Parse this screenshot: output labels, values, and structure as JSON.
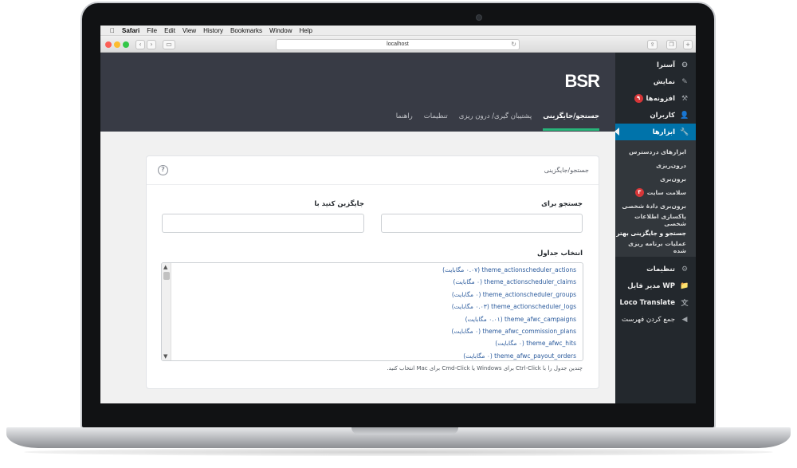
{
  "menubar": {
    "apple": "",
    "app": "Safari",
    "items": [
      "File",
      "Edit",
      "View",
      "History",
      "Bookmarks",
      "Window",
      "Help"
    ]
  },
  "browser": {
    "url": "localhost",
    "back": "‹",
    "forward": "›",
    "reload": "↻"
  },
  "plugin": {
    "logo": "BSR",
    "tabs": [
      {
        "label": "جستجو/جایگزینی",
        "active": true
      },
      {
        "label": "پشتیبان گیری/ درون ریزی",
        "active": false
      },
      {
        "label": "تنظیمات",
        "active": false
      },
      {
        "label": "راهنما",
        "active": false
      }
    ]
  },
  "card": {
    "title": "جستجو/جایگزینی",
    "help": "?",
    "search_label": "جستجو برای",
    "replace_label": "جایگزین کنید با",
    "tables_label": "انتخاب جداول",
    "tables": [
      "theme_actionscheduler_actions (۰.۰۷ مگابایت)",
      "theme_actionscheduler_claims (۰ مگابایت)",
      "theme_actionscheduler_groups (۰ مگابایت)",
      "theme_actionscheduler_logs (۰.۰۳ مگابایت)",
      "theme_afwc_campaigns (۰.۰۱ مگابایت)",
      "theme_afwc_commission_plans (۰ مگابایت)",
      "theme_afwc_hits (۰ مگابایت)",
      "theme_afwc_payout_orders (۰ مگابایت)"
    ],
    "hint": "چندین جدول را با Ctrl-Click برای Windows یا Cmd-Click برای Mac انتخاب کنید."
  },
  "sidebar": {
    "items": [
      {
        "label": "آسترا",
        "icon": "astra-icon",
        "glyph": "❽"
      },
      {
        "label": "نمایش",
        "icon": "appearance-icon",
        "glyph": "✎"
      },
      {
        "label": "افزونه‌ها",
        "icon": "plugins-icon",
        "glyph": "⚒",
        "badge": "۹"
      },
      {
        "label": "کاربران",
        "icon": "users-icon",
        "glyph": "👤"
      },
      {
        "label": "ابزارها",
        "icon": "tools-icon",
        "glyph": "🔧",
        "active": true
      }
    ],
    "subitems": [
      {
        "label": "ابزارهای دردسترس"
      },
      {
        "label": "درون‌ریزی"
      },
      {
        "label": "برون‌بری"
      },
      {
        "label": "سلامت سایت",
        "badge": "۳"
      },
      {
        "label": "برون‌بری دادهٔ شخصی"
      },
      {
        "label": "پاکسازی اطلاعات شخصی"
      },
      {
        "label": "جستجو و جایگزینی بهتر",
        "current": true
      },
      {
        "label": "عملیات برنامه ریزی شده"
      }
    ],
    "bottom_items": [
      {
        "label": "تنظیمات",
        "icon": "settings-icon",
        "glyph": "⚙"
      },
      {
        "label": "WP مدیر فایل",
        "icon": "folder-icon",
        "glyph": "📁"
      },
      {
        "label": "Loco Translate",
        "icon": "translate-icon",
        "glyph": "文"
      },
      {
        "label": "جمع کردن فهرست",
        "icon": "collapse-icon",
        "glyph": "◀"
      }
    ]
  }
}
